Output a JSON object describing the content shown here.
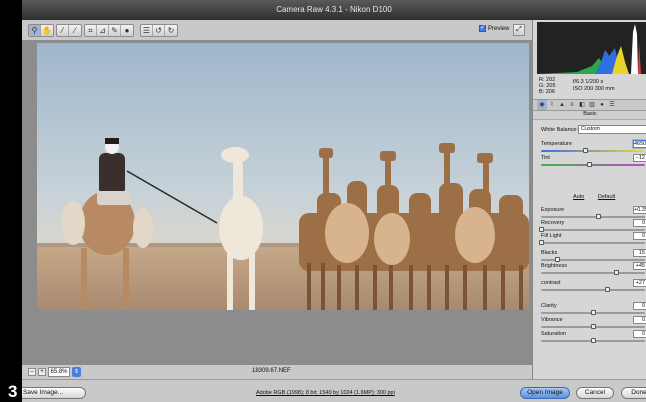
{
  "page_number": "3",
  "window": {
    "title": "Camera Raw 4.3.1 - Nikon D100"
  },
  "toolbar": {
    "tools": [
      {
        "name": "zoom-tool-icon",
        "glyph": "⚲"
      },
      {
        "name": "hand-tool-icon",
        "glyph": "✋"
      },
      {
        "name": "white-balance-tool-icon",
        "glyph": "⁄"
      },
      {
        "name": "color-sampler-tool-icon",
        "glyph": "⁄"
      },
      {
        "name": "crop-tool-icon",
        "glyph": "⌗"
      },
      {
        "name": "straighten-tool-icon",
        "glyph": "⊿"
      },
      {
        "name": "retouch-tool-icon",
        "glyph": "✎"
      },
      {
        "name": "red-eye-tool-icon",
        "glyph": "●"
      },
      {
        "name": "preferences-icon",
        "glyph": "☰"
      },
      {
        "name": "rotate-ccw-icon",
        "glyph": "↺"
      },
      {
        "name": "rotate-cw-icon",
        "glyph": "↻"
      }
    ],
    "preview_label": "Preview",
    "preview_checked": true
  },
  "zoom": {
    "level": "65.8%",
    "minus": "–",
    "plus": "+"
  },
  "filename": "18309.67.NEF",
  "histogram": {
    "background": "#222222"
  },
  "readout": {
    "r": "R:  202",
    "g": "G:  205",
    "b": "B:   206",
    "aperture_shutter": "f/6.3   1/200 s",
    "iso_focal": "ISO 200   300 mm"
  },
  "panel": {
    "title": "Basic",
    "white_balance_label": "White Balance:",
    "white_balance_value": "Custom",
    "auto_label": "Auto",
    "default_label": "Default",
    "sliders": [
      {
        "label": "Temperature",
        "value": "4650",
        "position": 0.42,
        "selected": true
      },
      {
        "label": "Tint",
        "value": "−12",
        "position": 0.46
      },
      {
        "label": "Exposure",
        "value": "+0.35",
        "position": 0.55
      },
      {
        "label": "Recovery",
        "value": "0",
        "position": 0.0
      },
      {
        "label": "Fill Light",
        "value": "0",
        "position": 0.0
      },
      {
        "label": "Blacks",
        "value": "15",
        "position": 0.15
      },
      {
        "label": "Brightness",
        "value": "+45",
        "position": 0.72
      },
      {
        "label": "contrast",
        "value": "+27",
        "position": 0.63
      },
      {
        "label": "Clarity",
        "value": "0",
        "position": 0.5
      },
      {
        "label": "Vibrance",
        "value": "0",
        "position": 0.5
      },
      {
        "label": "Saturation",
        "value": "0",
        "position": 0.5
      }
    ]
  },
  "bottom": {
    "save_label": "Save Image...",
    "workflow_text": "Adobe RGB (1998); 8 bit; 1540 by 1024 (1.6MP); 300 ppi",
    "open_label": "Open Image",
    "cancel_label": "Cancel",
    "done_label": "Done"
  },
  "colors": {
    "accent": "#4a7de0",
    "panel_bg": "#d6d6d6",
    "preview_bg": "#8c8c8c"
  }
}
